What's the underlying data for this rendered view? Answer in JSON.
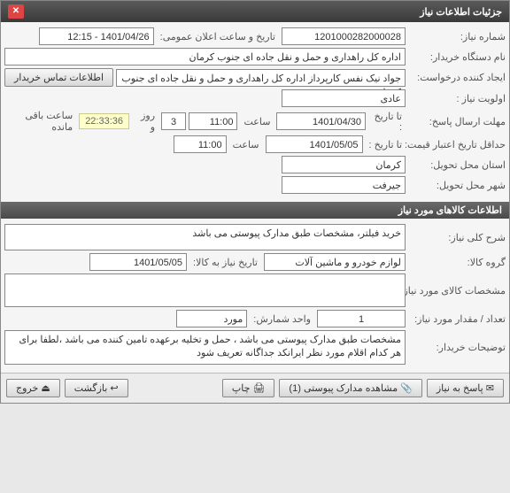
{
  "window": {
    "title": "جزئیات اطلاعات نیاز"
  },
  "form": {
    "need_number_label": "شماره نیاز:",
    "need_number": "1201000282000028",
    "announce_label": "تاریخ و ساعت اعلان عمومی:",
    "announce_value": "1401/04/26 - 12:15",
    "buyer_label": "نام دستگاه خریدار:",
    "buyer_value": "اداره کل راهداری و حمل و نقل جاده ای جنوب کرمان",
    "creator_label": "ایجاد کننده درخواست:",
    "creator_value": "جواد  نیک نفس کارپرداز اداره کل راهداری و حمل و نقل جاده ای جنوب کرمان",
    "buyer_contact_btn": "اطلاعات تماس خریدار",
    "priority_label": "اولویت نیاز :",
    "priority_value": "عادی",
    "deadline_label": "مهلت ارسال پاسخ:",
    "to_date_label": "تا تاریخ :",
    "deadline_date": "1401/04/30",
    "time_label": "ساعت",
    "deadline_time": "11:00",
    "days_count": "3",
    "days_and": "روز و",
    "remaining_time": "22:33:36",
    "remaining_label": "ساعت باقی مانده",
    "price_validity_label": "حداقل تاریخ اعتبار قیمت:",
    "price_validity_date": "1401/05/05",
    "price_validity_time": "11:00",
    "province_label": "استان محل تحویل:",
    "province_value": "کرمان",
    "city_label": "شهر محل تحویل:",
    "city_value": "جیرفت"
  },
  "goods": {
    "section_title": "اطلاعات کالاهای مورد نیاز",
    "desc_label": "شرح کلی نیاز:",
    "desc_value": "خرید فیلتر، مشخصات طبق مدارک پیوستی می باشد",
    "group_label": "گروه کالا:",
    "group_value": "لوازم خودرو و ماشین آلات",
    "need_date_label": "تاریخ نیاز به کالا:",
    "need_date_value": "1401/05/05",
    "spec_label": "مشخصات کالای مورد نیاز:",
    "spec_value": "",
    "qty_label": "تعداد / مقدار مورد نیاز:",
    "qty_value": "1",
    "unit_label": "واحد شمارش:",
    "unit_value": "مورد",
    "notes_label": "توضیحات خریدار:",
    "notes_value": "مشخصات طبق مدارک پیوستی می باشد ، حمل و تخلیه برعهده تامین کننده می باشد ،لطفا برای هر کدام اقلام مورد نظر ایرانکد جداگانه تعریف شود"
  },
  "buttons": {
    "respond": "پاسخ به نیاز",
    "attachments": "مشاهده مدارک پیوستی (1)",
    "print": "چاپ",
    "back": "بازگشت",
    "exit": "خروج"
  }
}
